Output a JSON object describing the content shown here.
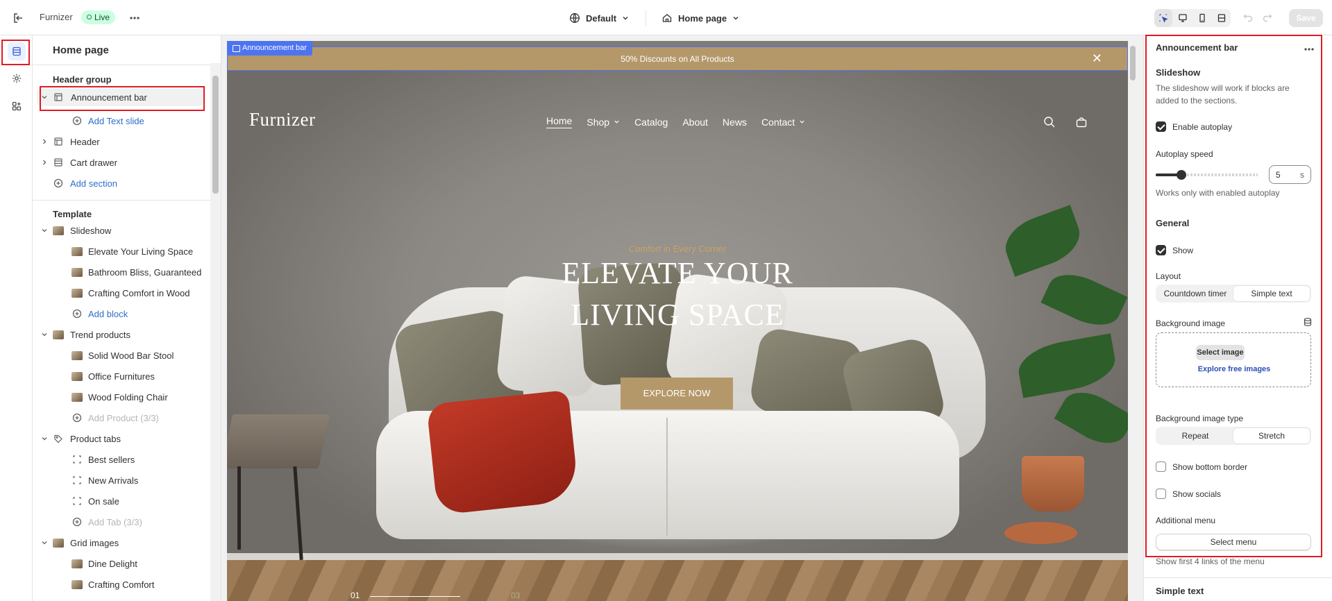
{
  "topbar": {
    "store_name": "Furnizer",
    "live_badge": "Live",
    "theme_label": "Default",
    "page_label": "Home page",
    "save_label": "Save"
  },
  "left_panel": {
    "title": "Home page",
    "header_group_title": "Header group",
    "header_items": [
      {
        "label": "Announcement bar",
        "icon": "layout-icon"
      },
      {
        "label": "Add Text slide",
        "icon": "plus-circle-icon"
      },
      {
        "label": "Header",
        "icon": "layout-icon"
      },
      {
        "label": "Cart drawer",
        "icon": "layout-icon"
      },
      {
        "label": "Add section",
        "icon": "plus-circle-icon"
      }
    ],
    "template_title": "Template",
    "template_items": [
      {
        "label": "Slideshow"
      },
      {
        "label": "Elevate Your Living Space"
      },
      {
        "label": "Bathroom Bliss, Guaranteed"
      },
      {
        "label": "Crafting Comfort in Wood"
      },
      {
        "label": "Add block"
      },
      {
        "label": "Trend products"
      },
      {
        "label": "Solid Wood Bar Stool"
      },
      {
        "label": "Office Furnitures"
      },
      {
        "label": "Wood Folding Chair"
      },
      {
        "label": "Add Product (3/3)"
      },
      {
        "label": "Product tabs"
      },
      {
        "label": "Best sellers"
      },
      {
        "label": "New Arrivals"
      },
      {
        "label": "On sale"
      },
      {
        "label": "Add Tab (3/3)"
      },
      {
        "label": "Grid images"
      },
      {
        "label": "Dine Delight"
      },
      {
        "label": "Crafting Comfort"
      }
    ]
  },
  "preview": {
    "section_tag": "Announcement bar",
    "announcement_text": "50% Discounts on All Products",
    "logo": "Furnizer",
    "nav": [
      "Home",
      "Shop",
      "Catalog",
      "About",
      "News",
      "Contact"
    ],
    "hero_subtitle": "Comfort in Every Corner",
    "hero_title_line1": "ELEVATE YOUR",
    "hero_title_line2": "LIVING SPACE",
    "hero_button": "EXPLORE NOW",
    "slide_current": "01",
    "slide_total": "03"
  },
  "right_panel": {
    "title": "Announcement bar",
    "slideshow_heading": "Slideshow",
    "slideshow_help": "The slideshow will work if blocks are added to the sections.",
    "enable_autoplay_label": "Enable autoplay",
    "enable_autoplay": true,
    "autoplay_speed_label": "Autoplay speed",
    "autoplay_speed_value": "5",
    "autoplay_speed_unit": "s",
    "autoplay_speed_fraction": 0.25,
    "autoplay_help": "Works only with enabled autoplay",
    "general_heading": "General",
    "show_label": "Show",
    "show": true,
    "layout_label": "Layout",
    "layout_options": [
      "Countdown timer",
      "Simple text"
    ],
    "layout_selected": "Simple text",
    "bg_image_label": "Background image",
    "select_image": "Select image",
    "explore_images": "Explore free images",
    "bg_type_label": "Background image type",
    "bg_type_options": [
      "Repeat",
      "Stretch"
    ],
    "bg_type_selected": "Stretch",
    "show_bottom_border_label": "Show bottom border",
    "show_bottom_border": false,
    "show_socials_label": "Show socials",
    "show_socials": false,
    "additional_menu_label": "Additional menu",
    "select_menu": "Select menu",
    "menu_help": "Show first 4 links of the menu",
    "simple_text_heading": "Simple text"
  },
  "colors": {
    "accent_blue": "#4d74f0",
    "brand_gold": "#b5986a",
    "highlight_red": "#e01b24",
    "live_green": "#cdfee1"
  }
}
